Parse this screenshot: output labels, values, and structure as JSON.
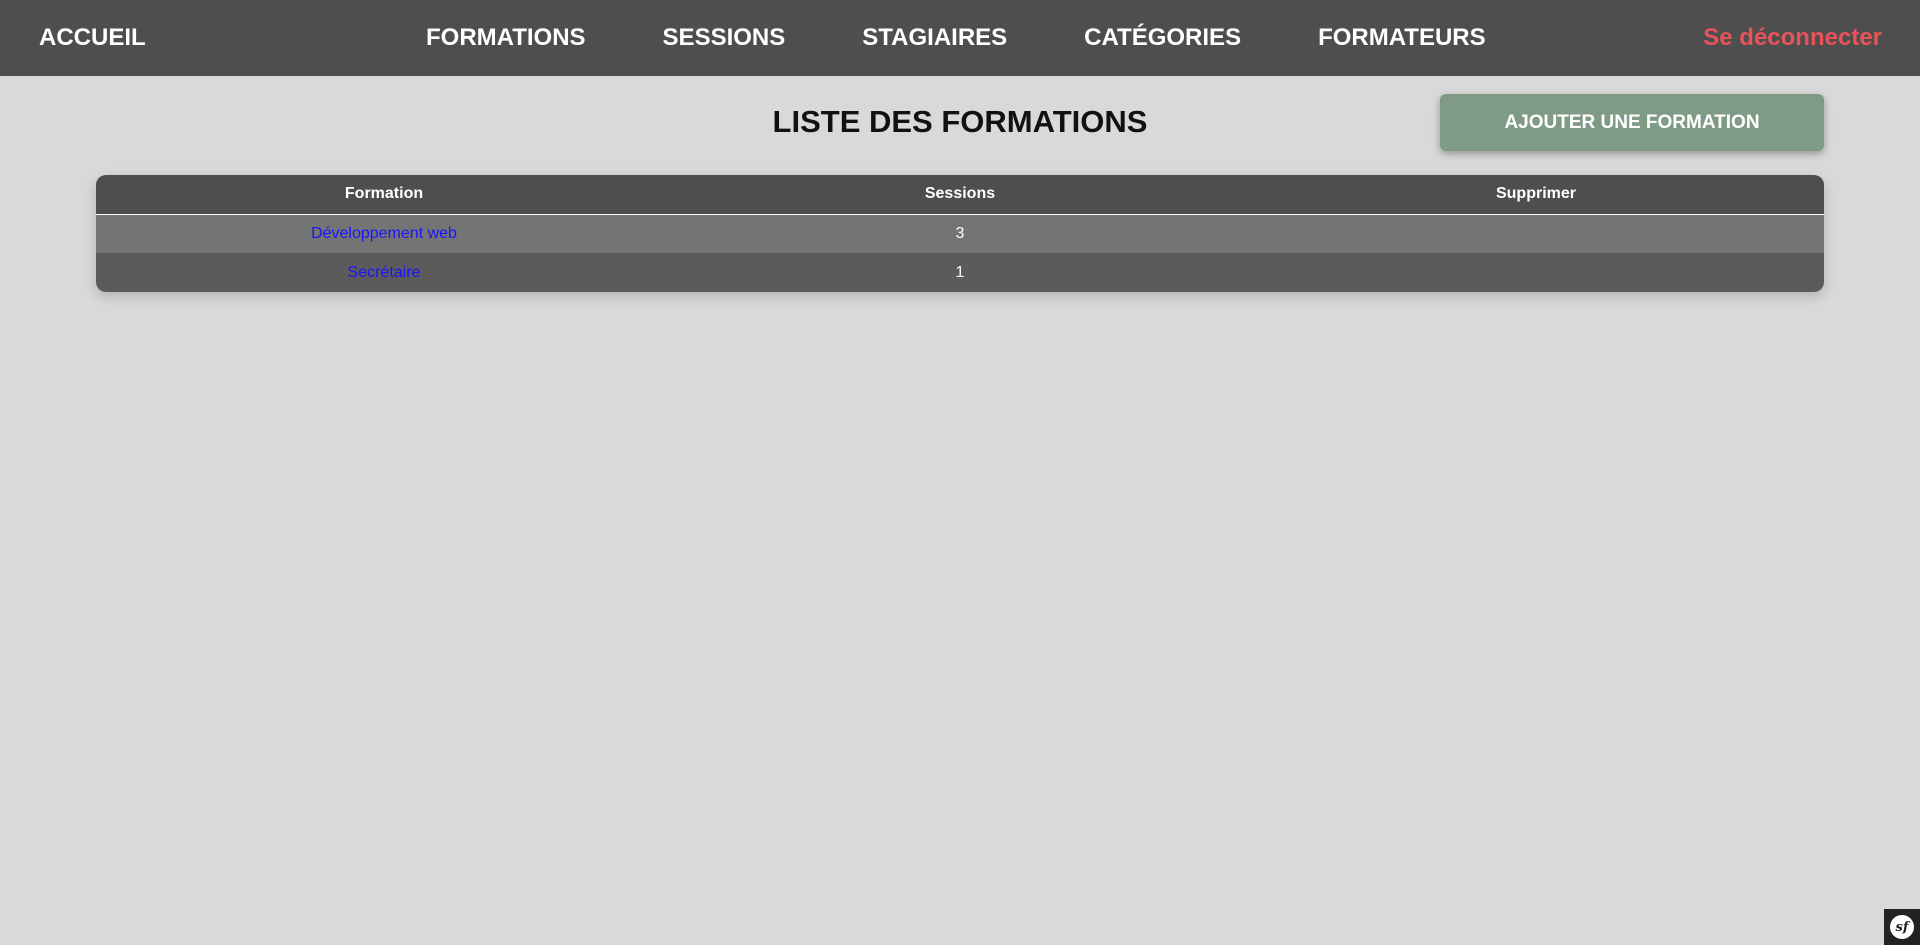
{
  "nav": {
    "home": "ACCUEIL",
    "items": [
      "FORMATIONS",
      "SESSIONS",
      "STAGIAIRES",
      "CATÉGORIES",
      "FORMATEURS"
    ],
    "logout": "Se déconnecter",
    "logout_color": "#e8535a",
    "background": "#4e4e4e"
  },
  "page": {
    "title": "LISTE DES FORMATIONS",
    "add_button": "AJOUTER UNE FORMATION",
    "add_button_color": "#7f9b86"
  },
  "table": {
    "headers": [
      "Formation",
      "Sessions",
      "Supprimer"
    ],
    "rows": [
      {
        "formation": "Développement web",
        "sessions": "3",
        "supprimer": ""
      },
      {
        "formation": "Secrétaire",
        "sessions": "1",
        "supprimer": ""
      }
    ]
  },
  "debug_toolbar": {
    "icon": "symfony-logo-icon"
  }
}
